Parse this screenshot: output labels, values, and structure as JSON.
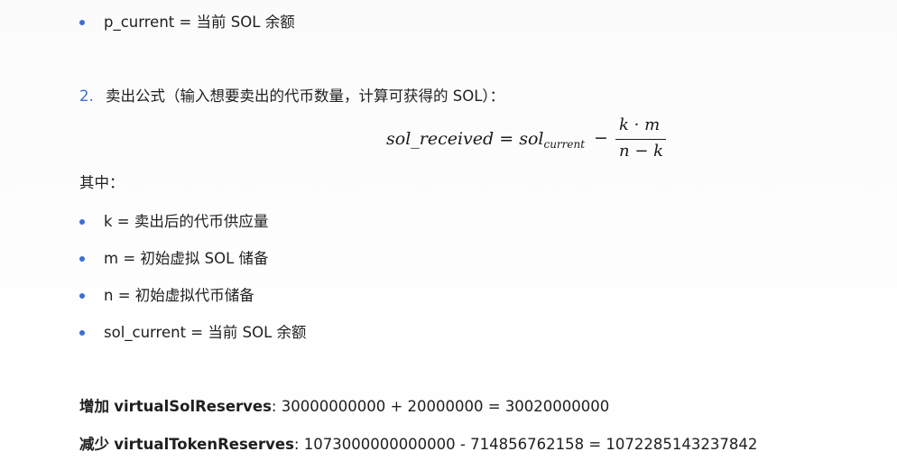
{
  "top_bullet": "p_current = 当前 SOL 余额",
  "section2": {
    "number": "2.",
    "title": "卖出公式（输入想要卖出的代币数量，计算可获得的 SOL）："
  },
  "formula": {
    "lhs": "sol_received = sol",
    "lhs_subscript": "current",
    "minus": "−",
    "numerator": "k · m",
    "denominator": "n − k"
  },
  "where_label": "其中：",
  "bullets": [
    "k = 卖出后的代币供应量",
    "m = 初始虚拟 SOL 储备",
    "n = 初始虚拟代币储备",
    "sol_current = 当前 SOL 余额"
  ],
  "sol_reserves": {
    "prefix": "增加",
    "name": "virtualSolReserves",
    "equation": ": 30000000000 + 20000000 = 30020000000"
  },
  "token_reserves": {
    "prefix": "减少",
    "name": "virtualTokenReserves",
    "equation": ": 1073000000000000 -  714856762158 = 1072285143237842"
  }
}
